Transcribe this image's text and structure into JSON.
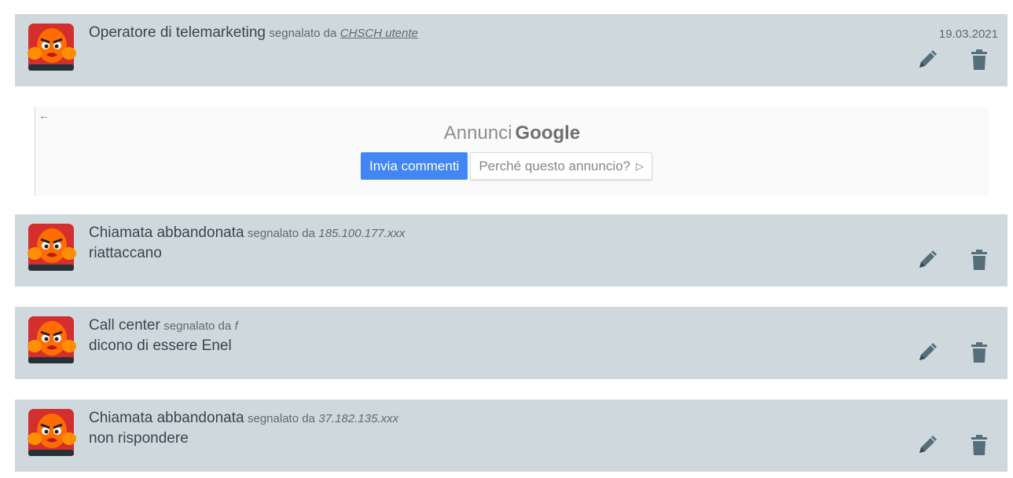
{
  "reports": [
    {
      "category": "Operatore di telemarketing",
      "by_label": "segnalato da",
      "author": "CHSCH utente",
      "comment": "",
      "date": "19.03.2021"
    },
    {
      "category": "Chiamata abbandonata",
      "by_label": "segnalato da",
      "author": "185.100.177.xxx",
      "comment": "riattaccano",
      "date": ""
    },
    {
      "category": "Call center",
      "by_label": "segnalato da",
      "author": "f",
      "comment": "dicono di essere Enel",
      "date": ""
    },
    {
      "category": "Chiamata abbandonata",
      "by_label": "segnalato da",
      "author": "37.182.135.xxx",
      "comment": "non rispondere",
      "date": ""
    }
  ],
  "ad": {
    "back_arrow": "←",
    "title_prefix": "Annunci",
    "title_brand": "Google",
    "feedback_button": "Invia commenti",
    "why_button": "Perché questo annuncio?",
    "why_icon": "▷"
  },
  "icons": {
    "avatar": "angry-face-avatar-icon",
    "edit": "pencil-icon",
    "delete": "trash-icon"
  },
  "colors": {
    "card_bg": "#cfd8dc",
    "text": "#37474f",
    "icon": "#546e7a",
    "ad_button_blue": "#4285f4"
  }
}
